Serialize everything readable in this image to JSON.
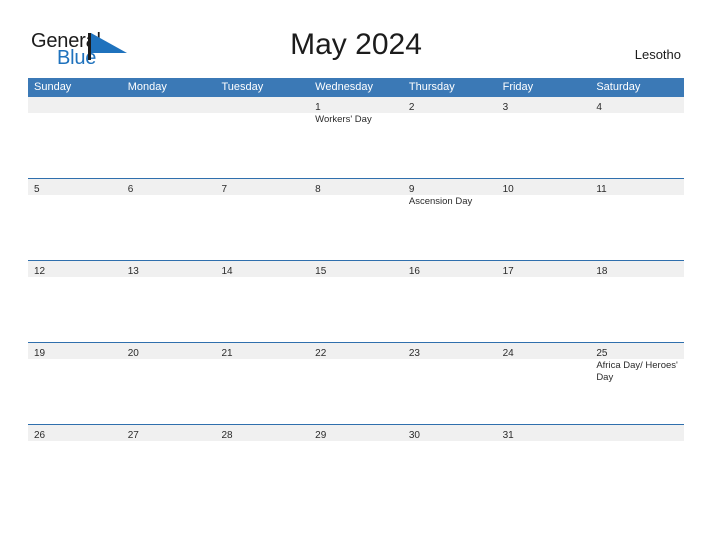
{
  "branding": {
    "logo_text_primary": "General",
    "logo_text_secondary": "Blue",
    "logo_triangle_color": "#1f72bd",
    "logo_primary_color": "#1c1c1c"
  },
  "header": {
    "title": "May 2024",
    "region": "Lesotho"
  },
  "theme": {
    "header_blue": "#3b79b6",
    "row_divider_blue": "#2f6fad",
    "daynum_strip_gray": "#f0f0f0",
    "cell_white": "#ffffff",
    "text_dark": "#2b2b2b"
  },
  "calendar": {
    "weekdays": [
      "Sunday",
      "Monday",
      "Tuesday",
      "Wednesday",
      "Thursday",
      "Friday",
      "Saturday"
    ],
    "weeks": [
      {
        "days": [
          {
            "date": "",
            "event": ""
          },
          {
            "date": "",
            "event": ""
          },
          {
            "date": "",
            "event": ""
          },
          {
            "date": "1",
            "event": "Workers' Day"
          },
          {
            "date": "2",
            "event": ""
          },
          {
            "date": "3",
            "event": ""
          },
          {
            "date": "4",
            "event": ""
          }
        ]
      },
      {
        "days": [
          {
            "date": "5",
            "event": ""
          },
          {
            "date": "6",
            "event": ""
          },
          {
            "date": "7",
            "event": ""
          },
          {
            "date": "8",
            "event": ""
          },
          {
            "date": "9",
            "event": "Ascension Day"
          },
          {
            "date": "10",
            "event": ""
          },
          {
            "date": "11",
            "event": ""
          }
        ]
      },
      {
        "days": [
          {
            "date": "12",
            "event": ""
          },
          {
            "date": "13",
            "event": ""
          },
          {
            "date": "14",
            "event": ""
          },
          {
            "date": "15",
            "event": ""
          },
          {
            "date": "16",
            "event": ""
          },
          {
            "date": "17",
            "event": ""
          },
          {
            "date": "18",
            "event": ""
          }
        ]
      },
      {
        "days": [
          {
            "date": "19",
            "event": ""
          },
          {
            "date": "20",
            "event": ""
          },
          {
            "date": "21",
            "event": ""
          },
          {
            "date": "22",
            "event": ""
          },
          {
            "date": "23",
            "event": ""
          },
          {
            "date": "24",
            "event": ""
          },
          {
            "date": "25",
            "event": "Africa Day/ Heroes' Day"
          }
        ]
      },
      {
        "days": [
          {
            "date": "26",
            "event": ""
          },
          {
            "date": "27",
            "event": ""
          },
          {
            "date": "28",
            "event": ""
          },
          {
            "date": "29",
            "event": ""
          },
          {
            "date": "30",
            "event": ""
          },
          {
            "date": "31",
            "event": ""
          },
          {
            "date": "",
            "event": ""
          }
        ]
      }
    ]
  }
}
